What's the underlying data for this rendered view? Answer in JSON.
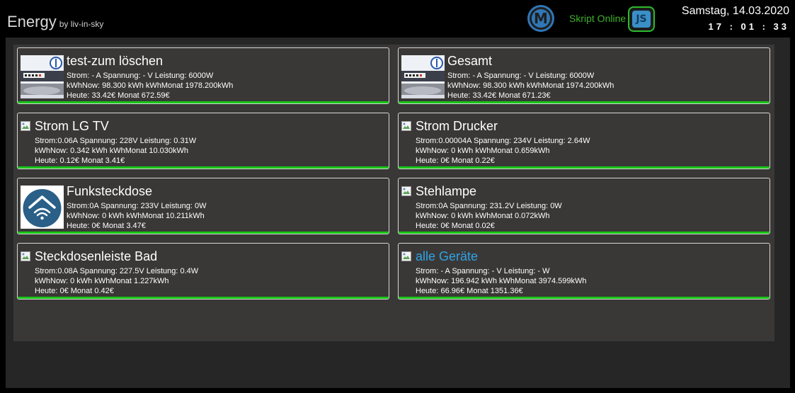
{
  "header": {
    "title": "Energy",
    "subtitle": "by liv-in-sky",
    "logo_icon": "m-logo-icon",
    "logo_letter": "M",
    "script_status": "Skript Online",
    "script_status_color": "#3fb22b",
    "js_icon": "js-badge-icon",
    "js_letters": "JS",
    "date": "Samstag, 14.03.2020",
    "time": "17 : 01 : 33"
  },
  "colors": {
    "accent": "#2fa3e6",
    "status_bar": "#18c718",
    "card_bg": "#3a3837"
  },
  "devices": [
    {
      "name": "test-zum löschen",
      "icon": "electric-meter-image",
      "line1": "Strom: - A Spannung: - V Leistung: 6000W",
      "line2": "kWhNow: 98.300 kWh kWhMonat 1978.200kWh",
      "line3": "Heute: 33.42€ Monat 672.59€"
    },
    {
      "name": "Gesamt",
      "icon": "electric-meter-image",
      "line1": "Strom: - A Spannung: - V Leistung: 6000W",
      "line2": "kWhNow: 98.300 kWh kWhMonat 1974.200kWh",
      "line3": "Heute: 33.42€ Monat 671.23€"
    },
    {
      "name": "Strom LG TV",
      "icon": "broken-image-icon",
      "line1": "Strom:0.06A Spannung: 228V Leistung: 0.31W",
      "line2": "kWhNow: 0.342 kWh kWhMonat 10.030kWh",
      "line3": "Heute: 0.12€ Monat 3.41€"
    },
    {
      "name": "Strom Drucker",
      "icon": "broken-image-icon",
      "line1": "Strom:0.00004A Spannung: 234V Leistung: 2.64W",
      "line2": "kWhNow: 0 kWh kWhMonat 0.659kWh",
      "line3": "Heute: 0€ Monat 0.22€"
    },
    {
      "name": "Funksteckdose",
      "icon": "smart-home-wifi-icon",
      "line1": "Strom:0A Spannung: 233V Leistung: 0W",
      "line2": "kWhNow: 0 kWh kWhMonat 10.211kWh",
      "line3": "Heute: 0€ Monat 3.47€"
    },
    {
      "name": "Stehlampe",
      "icon": "broken-image-icon",
      "line1": "Strom:0A Spannung: 231.2V Leistung: 0W",
      "line2": "kWhNow: 0 kWh kWhMonat 0.072kWh",
      "line3": "Heute: 0€ Monat 0.02€"
    },
    {
      "name": "Steckdosenleiste Bad",
      "icon": "broken-image-icon",
      "line1": "Strom:0.08A Spannung: 227.5V Leistung: 0.4W",
      "line2": "kWhNow: 0 kWh kWhMonat 1.227kWh",
      "line3": "Heute: 0€ Monat 0.42€"
    },
    {
      "name": "alle Geräte",
      "icon": "broken-image-icon",
      "accent": true,
      "line1": "Strom: - A Spannung: - V Leistung: - W",
      "line2": "kWhNow: 196.942 kWh kWhMonat 3974.599kWh",
      "line3": "Heute: 66.96€ Monat 1351.36€"
    }
  ]
}
